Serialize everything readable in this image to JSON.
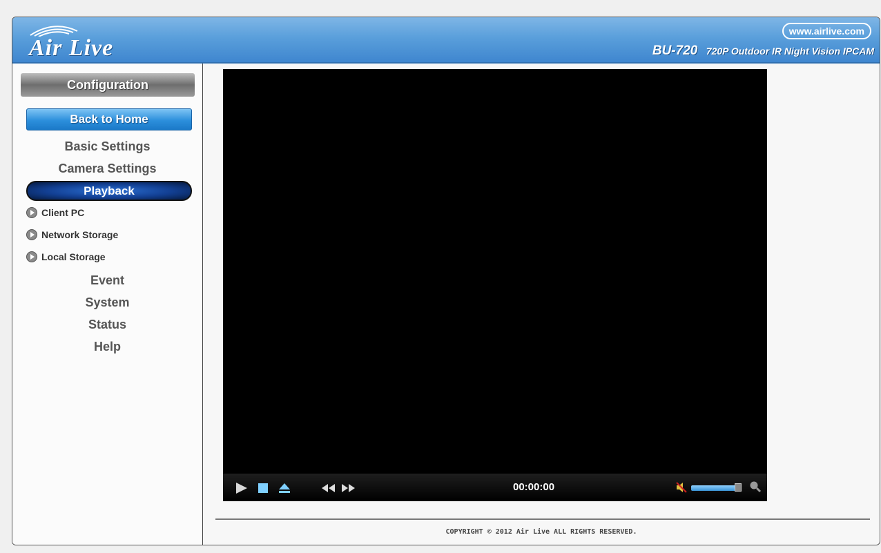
{
  "header": {
    "logo_text": "Air Live",
    "url": "www.airlive.com",
    "model_code": "BU-720",
    "model_desc": "720P Outdoor IR Night Vision IPCAM",
    "colors": {
      "header_blue": "#4a93d6",
      "accent_blue": "#2c8fdc"
    }
  },
  "sidebar": {
    "config_label": "Configuration",
    "back_label": "Back to Home",
    "items": [
      {
        "label": "Basic Settings"
      },
      {
        "label": "Camera Settings"
      }
    ],
    "playback_label": "Playback",
    "playback_items": [
      {
        "label": "Client PC",
        "icon": "play-circle-icon"
      },
      {
        "label": "Network Storage",
        "icon": "play-circle-icon"
      },
      {
        "label": "Local Storage",
        "icon": "play-circle-icon"
      }
    ],
    "bottom_items": [
      {
        "label": "Event"
      },
      {
        "label": "System"
      },
      {
        "label": "Status"
      },
      {
        "label": "Help"
      }
    ]
  },
  "player": {
    "time": "00:00:00",
    "icons": [
      "play-icon",
      "stop-icon",
      "eject-icon",
      "rewind-icon",
      "fast-forward-icon",
      "mute-icon",
      "zoom-icon"
    ],
    "volume_level": 0.9
  },
  "footer": {
    "copyright": "COPYRIGHT © 2012 Air Live ALL RIGHTS RESERVED."
  }
}
